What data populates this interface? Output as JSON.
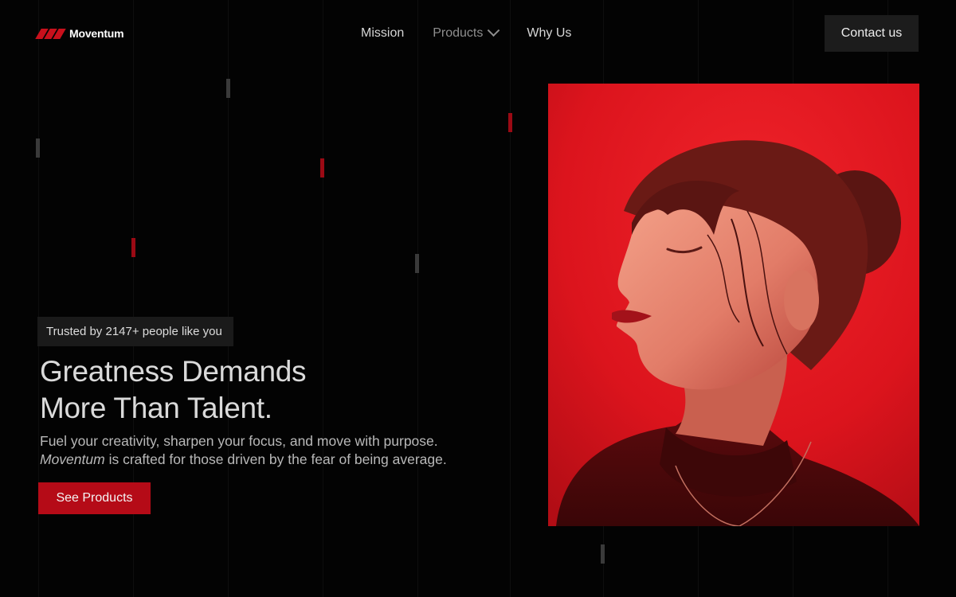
{
  "brand": {
    "name": "Moventum"
  },
  "nav": {
    "items": [
      {
        "label": "Mission"
      },
      {
        "label": "Products",
        "has_dropdown": true
      },
      {
        "label": "Why Us"
      }
    ],
    "contact_label": "Contact us"
  },
  "hero": {
    "badge": "Trusted by 2147+ people like you",
    "headline_line1": "Greatness Demands",
    "headline_line2": "More Than Talent.",
    "sub_line1": "Fuel your creativity, sharpen your focus, and move with purpose.",
    "sub_brand": "Moventum",
    "sub_line2_rest": " is crafted for those driven by the fear of being average.",
    "cta_label": "See Products",
    "image_alt": "Woman with eyes closed against a red background"
  },
  "colors": {
    "background": "#030303",
    "accent": "#b50b17",
    "image_bg": "#e31620"
  }
}
